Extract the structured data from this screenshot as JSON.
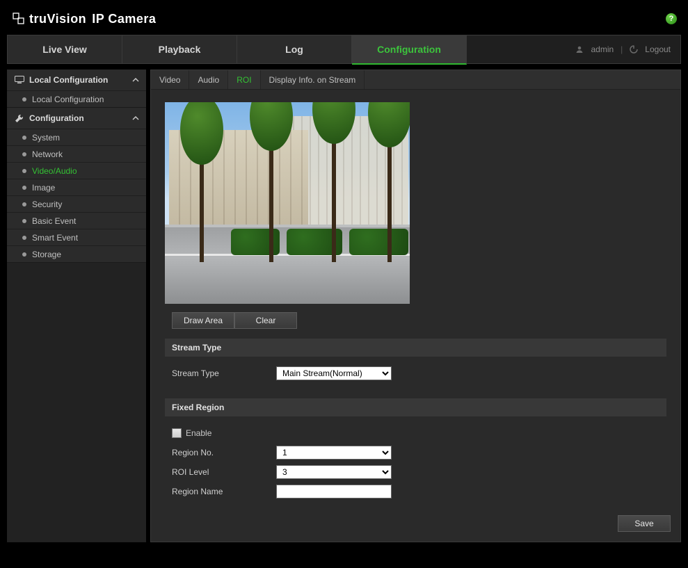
{
  "brand": {
    "name": "truVision",
    "product": "IP Camera"
  },
  "topnav": {
    "tabs": [
      {
        "label": "Live View"
      },
      {
        "label": "Playback"
      },
      {
        "label": "Log"
      },
      {
        "label": "Configuration"
      }
    ],
    "user": "admin",
    "logout_label": "Logout"
  },
  "sidebar": {
    "groups": [
      {
        "title": "Local Configuration",
        "items": [
          {
            "label": "Local Configuration"
          }
        ]
      },
      {
        "title": "Configuration",
        "items": [
          {
            "label": "System"
          },
          {
            "label": "Network"
          },
          {
            "label": "Video/Audio"
          },
          {
            "label": "Image"
          },
          {
            "label": "Security"
          },
          {
            "label": "Basic Event"
          },
          {
            "label": "Smart Event"
          },
          {
            "label": "Storage"
          }
        ]
      }
    ]
  },
  "subtabs": [
    {
      "label": "Video"
    },
    {
      "label": "Audio"
    },
    {
      "label": "ROI"
    },
    {
      "label": "Display Info. on Stream"
    }
  ],
  "buttons": {
    "draw_area": "Draw Area",
    "clear": "Clear",
    "save": "Save"
  },
  "sections": {
    "stream_type": {
      "heading": "Stream Type",
      "label": "Stream Type",
      "value": "Main Stream(Normal)"
    },
    "fixed_region": {
      "heading": "Fixed Region",
      "enable_label": "Enable",
      "enable_checked": false,
      "region_no_label": "Region No.",
      "region_no_value": "1",
      "roi_level_label": "ROI Level",
      "roi_level_value": "3",
      "region_name_label": "Region Name",
      "region_name_value": ""
    }
  }
}
